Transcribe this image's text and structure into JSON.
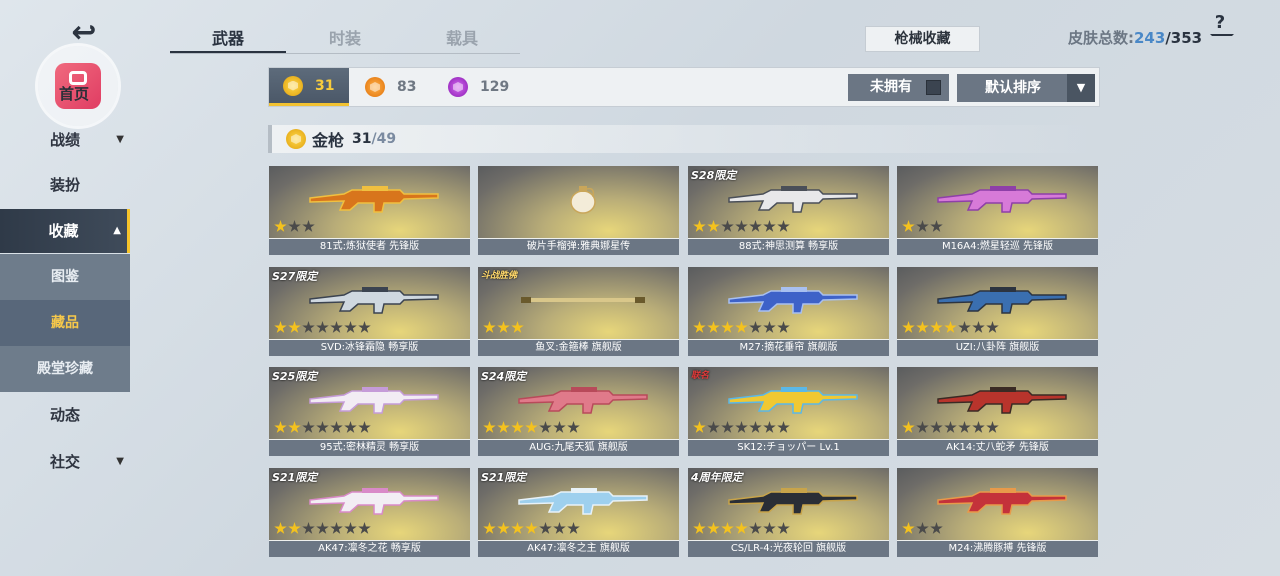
{
  "sidebar": {
    "avatar_label": "首页",
    "items": [
      {
        "label": "战绩",
        "arrow": "▼"
      },
      {
        "label": "装扮",
        "arrow": ""
      },
      {
        "label": "收藏",
        "arrow": "▲"
      },
      {
        "label": "图鉴"
      },
      {
        "label": "藏品"
      },
      {
        "label": "殿堂珍藏"
      },
      {
        "label": "动态",
        "arrow": ""
      },
      {
        "label": "社交",
        "arrow": "▼"
      }
    ]
  },
  "tabs": [
    "武器",
    "时装",
    "载具"
  ],
  "collect_button": "枪械收藏",
  "skin_total": {
    "label": "皮肤总数:",
    "current": "243",
    "total": "/353"
  },
  "help": "?",
  "filters": [
    {
      "count": "31",
      "color": "gold"
    },
    {
      "count": "83",
      "color": "orange"
    },
    {
      "count": "129",
      "color": "purple"
    }
  ],
  "unowned_label": "未拥有",
  "sort_label": "默认排序",
  "section": {
    "title": "金枪",
    "owned": "31",
    "total": "/49"
  },
  "colors": {
    "gold": "#f4c21e",
    "accent_blue": "#4a88c7",
    "panel": "#6b7684"
  },
  "cards": [
    {
      "name": "81式:炼狱使者 先锋版",
      "tag": "",
      "stars": 1,
      "max": 3,
      "gun": [
        "#d8751c",
        "#f0c040"
      ]
    },
    {
      "name": "破片手榴弹:雅典娜星传",
      "tag": "",
      "stars": 0,
      "max": 0,
      "gun": [
        "#f3ecd9",
        "#c9a65a"
      ],
      "type": "grenade"
    },
    {
      "name": "88式:神思测算 畅享版",
      "tag": "S28限定",
      "stars": 2,
      "max": 7,
      "gun": [
        "#e8e8ea",
        "#4a4f58"
      ]
    },
    {
      "name": "M16A4:燃星轻巡 先锋版",
      "tag": "",
      "stars": 1,
      "max": 3,
      "gun": [
        "#d77ad8",
        "#8e3fa8"
      ]
    },
    {
      "name": "SVD:冰锋霜隐 畅享版",
      "tag": "S27限定",
      "stars": 2,
      "max": 7,
      "gun": [
        "#cfd8e0",
        "#3b4350"
      ]
    },
    {
      "name": "鱼叉:金箍棒 旗舰版",
      "tag": "斗战胜佛",
      "stars": 3,
      "max": 3,
      "gun": [
        "#d9c78a",
        "#6a5a2c"
      ],
      "tagstyle": "small",
      "type": "staff"
    },
    {
      "name": "M27:摘花垂帘 旗舰版",
      "tag": "",
      "stars": 4,
      "max": 7,
      "gun": [
        "#3e62c8",
        "#a8c0f0"
      ]
    },
    {
      "name": "UZI:八卦阵 旗舰版",
      "tag": "",
      "stars": 4,
      "max": 7,
      "gun": [
        "#3a6fb0",
        "#2c3440"
      ]
    },
    {
      "name": "95式:密林精灵 畅享版",
      "tag": "S25限定",
      "stars": 2,
      "max": 7,
      "gun": [
        "#f2ecf4",
        "#c59bd8"
      ]
    },
    {
      "name": "AUG:九尾天狐 旗舰版",
      "tag": "S24限定",
      "stars": 4,
      "max": 7,
      "gun": [
        "#e07a8a",
        "#b84a5a"
      ]
    },
    {
      "name": "SK12:チョッパー Lv.1",
      "tag": "联名",
      "stars": 1,
      "max": 7,
      "gun": [
        "#f0c832",
        "#5ab8e8"
      ],
      "tagstyle": "red"
    },
    {
      "name": "AK14:丈八蛇矛 先锋版",
      "tag": "",
      "stars": 1,
      "max": 7,
      "gun": [
        "#b8342c",
        "#3a2a24"
      ]
    },
    {
      "name": "AK47:凛冬之花 畅享版",
      "tag": "S21限定",
      "stars": 2,
      "max": 7,
      "gun": [
        "#f2eef4",
        "#d98ac8"
      ]
    },
    {
      "name": "AK47:凛冬之主 旗舰版",
      "tag": "S21限定",
      "stars": 4,
      "max": 7,
      "gun": [
        "#9ed0ee",
        "#e8f2f8"
      ]
    },
    {
      "name": "CS/LR-4:光夜轮回 旗舰版",
      "tag": "4周年限定",
      "stars": 4,
      "max": 7,
      "gun": [
        "#2a2e36",
        "#c8a44a"
      ]
    },
    {
      "name": "M24:沸腾豚搏 先锋版",
      "tag": "",
      "stars": 1,
      "max": 3,
      "gun": [
        "#c4323a",
        "#e89a4a"
      ]
    }
  ]
}
